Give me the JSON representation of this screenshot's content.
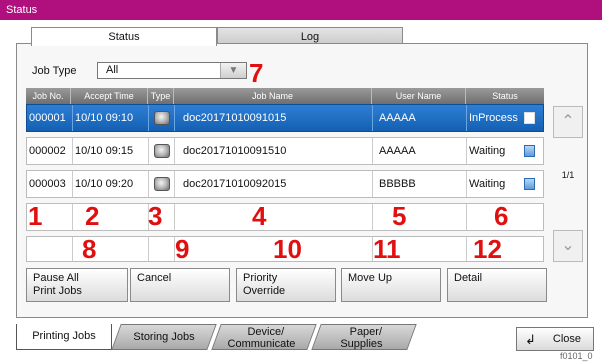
{
  "window": {
    "title": "Status"
  },
  "tabs": [
    {
      "label": "Status"
    },
    {
      "label": "Log"
    }
  ],
  "filter": {
    "label": "Job Type",
    "value": "All"
  },
  "table": {
    "headers": [
      "Job No.",
      "Accept Time",
      "Type",
      "Job Name",
      "User Name",
      "Status"
    ],
    "rows": [
      {
        "job_no": "000001",
        "time": "10/10 09:10",
        "name": "doc20171010091015",
        "user": "AAAAA",
        "status": "InProcess"
      },
      {
        "job_no": "000002",
        "time": "10/10 09:15",
        "name": "doc20171010091510",
        "user": "AAAAA",
        "status": "Waiting"
      },
      {
        "job_no": "000003",
        "time": "10/10 09:20",
        "name": "doc20171010092015",
        "user": "BBBBB",
        "status": "Waiting"
      }
    ],
    "page_indicator": "1/1"
  },
  "callouts": [
    "1",
    "2",
    "3",
    "4",
    "5",
    "6",
    "7",
    "8",
    "9",
    "10",
    "11",
    "12"
  ],
  "actions": {
    "pause_all": [
      "Pause All",
      "Print Jobs"
    ],
    "cancel": "Cancel",
    "priority": [
      "Priority",
      "Override"
    ],
    "move_up": "Move Up",
    "detail": "Detail"
  },
  "bottom_tabs": {
    "printing": "Printing Jobs",
    "storing": "Storing Jobs",
    "device": [
      "Device/",
      "Communicate"
    ],
    "paper": [
      "Paper/",
      "Supplies"
    ]
  },
  "close": "Close",
  "footer_code": "f0101_0",
  "colors": {
    "title_bar": "#b0107e",
    "selected_row": "#1f6fc4",
    "callout": "#e01010"
  }
}
